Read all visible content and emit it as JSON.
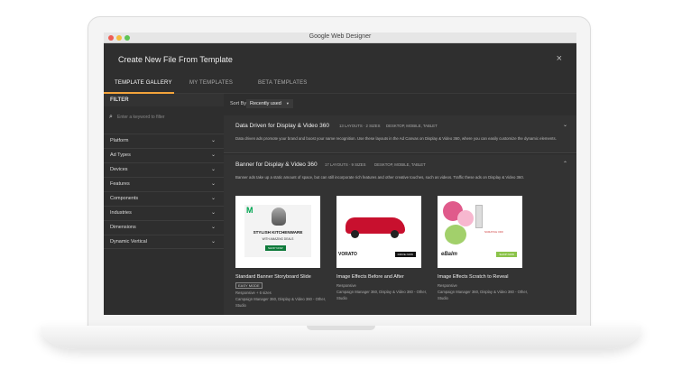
{
  "window": {
    "app_title": "Google Web Designer"
  },
  "dialog": {
    "title": "Create New File From Template",
    "close_icon": "×"
  },
  "tabs": [
    {
      "label": "TEMPLATE GALLERY",
      "active": true
    },
    {
      "label": "MY TEMPLATES",
      "active": false
    },
    {
      "label": "BETA TEMPLATES",
      "active": false
    }
  ],
  "filter": {
    "header": "FILTER",
    "search_placeholder": "Enter a keyword to filter",
    "items": [
      "Platform",
      "Ad Types",
      "Devices",
      "Features",
      "Components",
      "Industries",
      "Dimensions",
      "Dynamic Vertical"
    ]
  },
  "sort": {
    "label": "Sort By:",
    "value": "Recently used"
  },
  "sections": [
    {
      "title": "Data Driven for Display & Video 360",
      "layouts": "13 LAYOUTS · 2 SIZES",
      "devices": "DESKTOP, MOBILE, TABLET",
      "description": "Data driven ads promote your brand and boost your name recognition. Use these layouts in the Ad Canvas on Display & Video 360, where you can easily customize the dynamic elements."
    },
    {
      "title": "Banner for Display & Video 360",
      "layouts": "17 LAYOUTS · 9 SIZES",
      "devices": "DESKTOP, MOBILE, TABLET",
      "description": "Banner ads take up a static amount of space, but can still incorporate rich features and other creative touches, such as videos. Traffic these ads on Display & Video 360."
    }
  ],
  "cards": [
    {
      "title": "Standard Banner Storyboard Slide",
      "badge": "EASY MODE",
      "line1": "Responsive + 6 sizes",
      "line2": "Campaign Manager 360, Display & Video 360 - Other, Studio",
      "thumb": {
        "logo": "M",
        "headline": "STYLISH KITCHENWARE",
        "sub": "WITH AMAZING DEALS",
        "cta": "SHOP NOW"
      }
    },
    {
      "title": "Image Effects Before and After",
      "badge": "",
      "line1": "Responsive",
      "line2": "Campaign Manager 360, Display & Video 360 - Other, Studio",
      "thumb": {
        "brand": "VORATO",
        "cta": "DRIVE NOW"
      }
    },
    {
      "title": "Image Effects Scratch to Reveal",
      "badge": "",
      "line1": "Responsive",
      "line2": "Campaign Manager 360, Display & Video 360 - Other, Studio",
      "thumb": {
        "top": "SCRATCH OFF",
        "brand": "eBalm",
        "cta": "SHOP NOW"
      }
    }
  ]
}
